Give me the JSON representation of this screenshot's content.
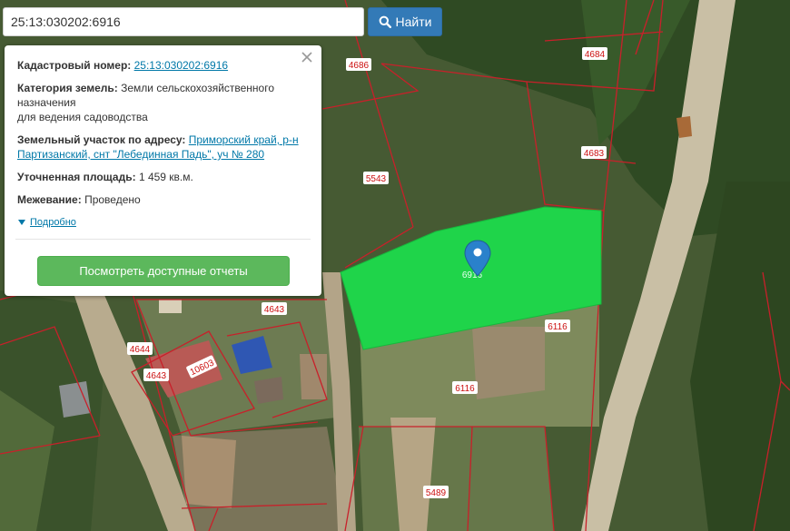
{
  "search": {
    "value": "25:13:030202:6916",
    "button_label": "Найти"
  },
  "popup": {
    "cad_label": "Кадастровый номер:",
    "cad_value": "25:13:030202:6916",
    "cat_label": "Категория земель:",
    "cat_value_1": "Земли сельскохозяйственного",
    "cat_value_2": "назначения",
    "cat_value_3": "для ведения садоводства",
    "addr_label": "Земельный участок по адресу:",
    "addr_value_1": "Приморский край, р-н",
    "addr_value_2": "Партизанский, снт \"Лебединная Падь\", уч № 280",
    "area_label": "Уточненная площадь:",
    "area_value": "1 459 кв.м.",
    "survey_label": "Межевание:",
    "survey_value": "Проведено",
    "more_label": "Подробно",
    "report_button": "Посмотреть доступные отчеты"
  },
  "map": {
    "selected_plot_label": "6916",
    "plot_labels": [
      "4686",
      "4684",
      "4683",
      "5543",
      "4643",
      "4644",
      "4643",
      "10603",
      "6116",
      "6116",
      "5489"
    ],
    "colors": {
      "selected": "#1fd44a",
      "boundary": "#c8202a",
      "label_bg": "#ffffff",
      "label_text": "#c11"
    }
  },
  "icons": {
    "search": "search-icon",
    "close": "close-icon",
    "more": "caret-down-icon",
    "marker": "map-marker-icon"
  }
}
